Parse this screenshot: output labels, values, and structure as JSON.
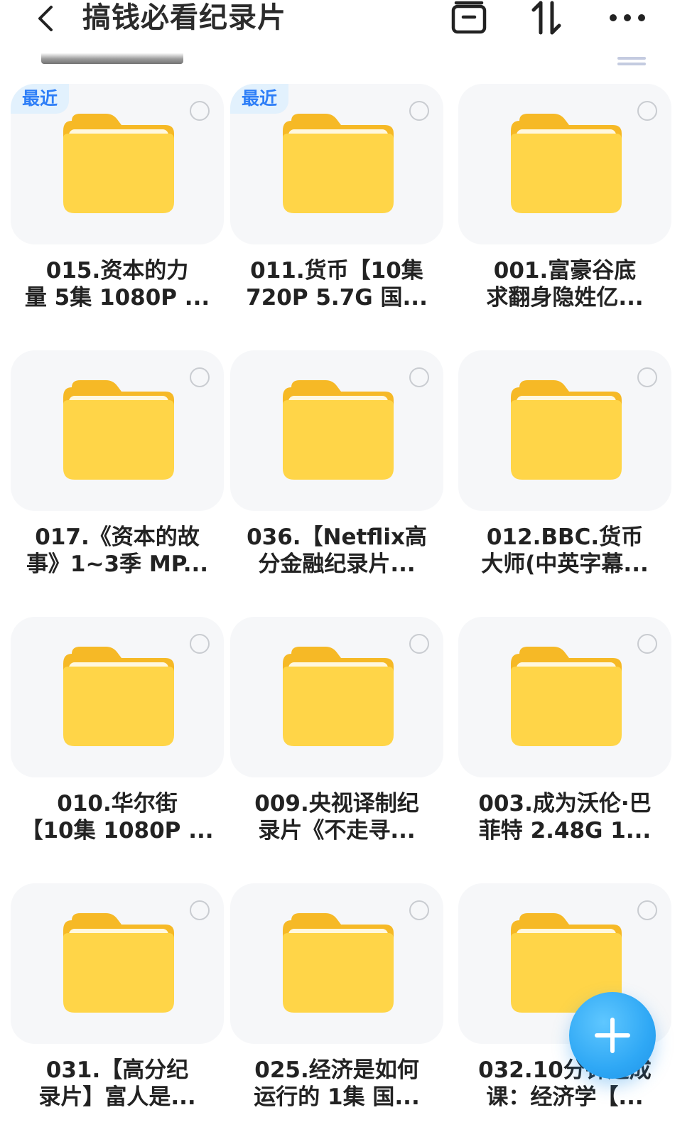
{
  "header": {
    "title": "搞钱必看纪录片",
    "back_icon": "chevron-left-icon",
    "archive_icon": "archive-box-icon",
    "sort_icon": "sort-arrows-icon",
    "more_icon": "more-horizontal-icon"
  },
  "badge_label": "最近",
  "colors": {
    "accent": "#2d7ef7",
    "badge_bg": "#e2f1fd",
    "folder_yellow": "#ffd54a",
    "fab": "#2fa8f5",
    "tile_bg": "#f6f7f9"
  },
  "folders": [
    {
      "line1": "015.资本的力",
      "line2": "量 5集 1080P ...",
      "recent": true
    },
    {
      "line1": "011.货币【10集",
      "line2": "720P 5.7G 国...",
      "recent": true
    },
    {
      "line1": "001.富豪谷底",
      "line2": "求翻身隐姓亿...",
      "recent": false
    },
    {
      "line1": "017.《资本的故",
      "line2": "事》1~3季 MP...",
      "recent": false
    },
    {
      "line1": "036.【Netflix高",
      "line2": "分金融纪录片...",
      "recent": false
    },
    {
      "line1": "012.BBC.货币",
      "line2": "大师(中英字幕...",
      "recent": false
    },
    {
      "line1": "010.华尔街",
      "line2": "【10集 1080P ...",
      "recent": false
    },
    {
      "line1": "009.央视译制纪",
      "line2": "录片《不走寻...",
      "recent": false
    },
    {
      "line1": "003.成为沃伦·巴",
      "line2": "菲特 2.48G 1...",
      "recent": false
    },
    {
      "line1": "031.【高分纪",
      "line2": "录片】富人是...",
      "recent": false
    },
    {
      "line1": "025.经济是如何",
      "line2": "运行的 1集 国...",
      "recent": false
    },
    {
      "line1": "032.10分钟速成",
      "line2": "课：经济学【...",
      "recent": false
    }
  ],
  "fab_icon": "plus-icon"
}
